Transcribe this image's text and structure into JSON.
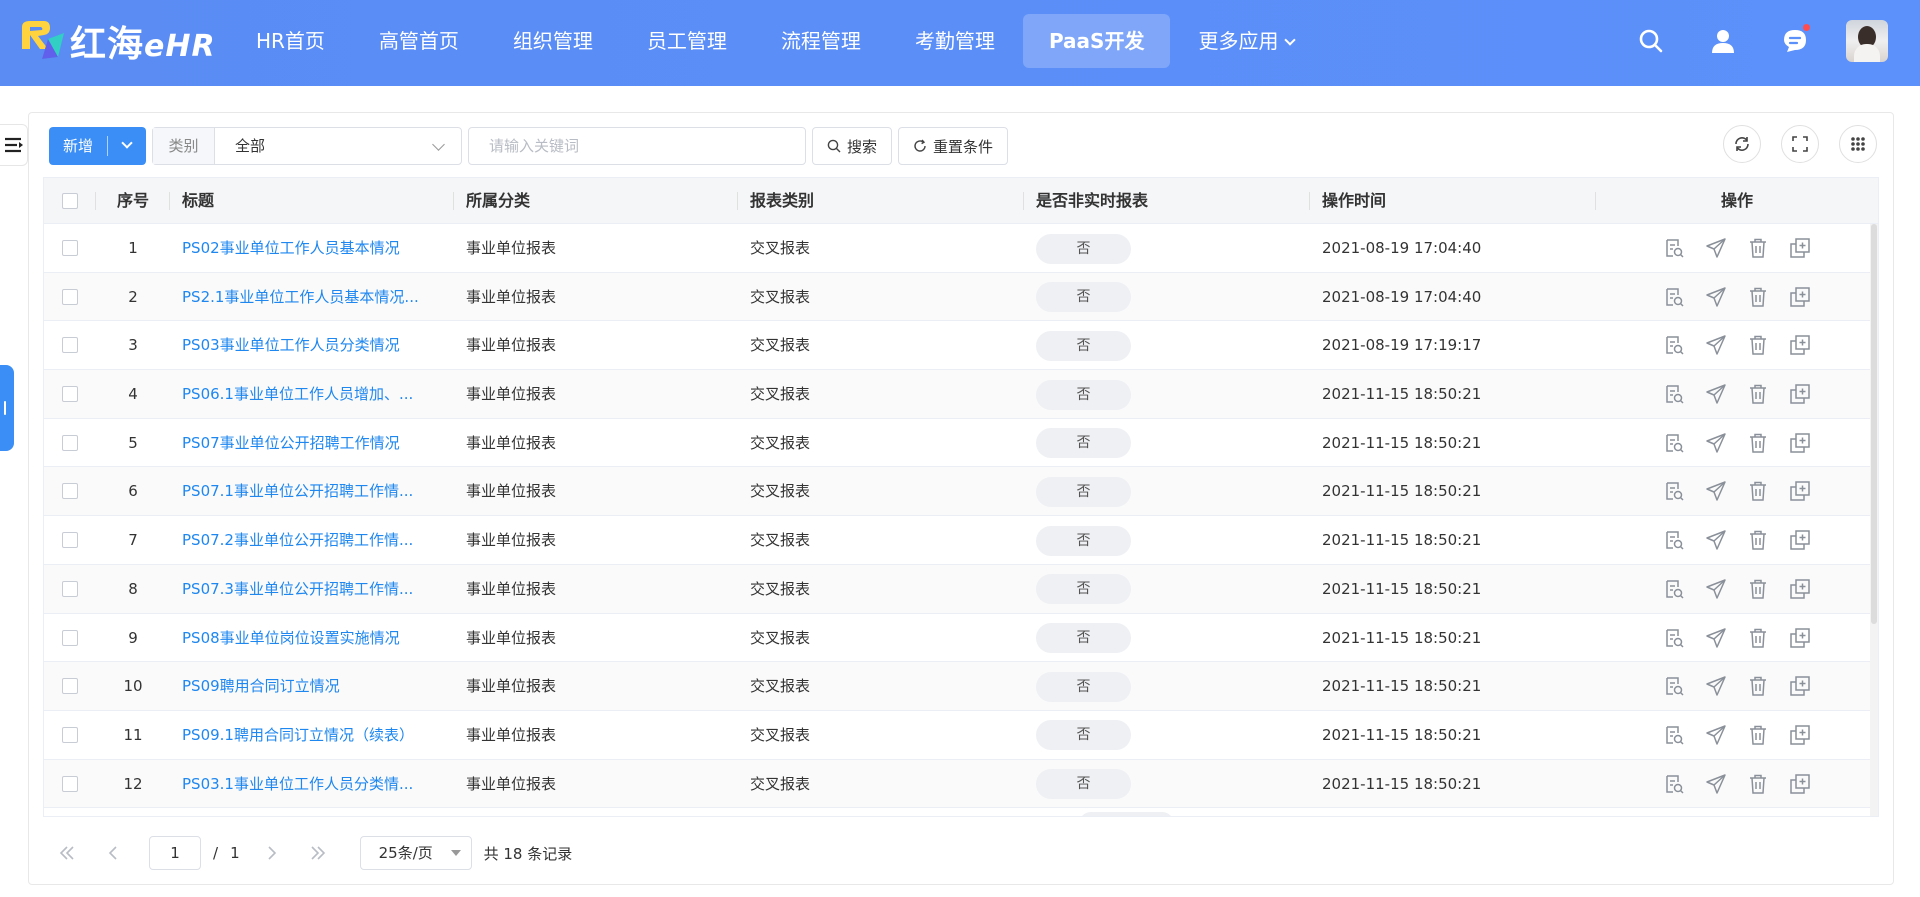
{
  "header": {
    "logo_cn": "红海",
    "logo_en": "eHR",
    "nav": [
      {
        "label": "HR首页",
        "active": false
      },
      {
        "label": "高管首页",
        "active": false
      },
      {
        "label": "组织管理",
        "active": false
      },
      {
        "label": "员工管理",
        "active": false
      },
      {
        "label": "流程管理",
        "active": false
      },
      {
        "label": "考勤管理",
        "active": false
      },
      {
        "label": "PaaS开发",
        "active": true
      },
      {
        "label": "更多应用",
        "active": false
      }
    ],
    "icons": [
      "search-icon",
      "user-icon",
      "message-icon",
      "avatar"
    ]
  },
  "toolbar": {
    "add_label": "新增",
    "category_label": "类别",
    "category_value": "全部",
    "search_placeholder": "请输入关键词",
    "search_label": "搜索",
    "reset_label": "重置条件"
  },
  "table": {
    "columns": {
      "index": "序号",
      "title": "标题",
      "category": "所属分类",
      "type": "报表类别",
      "realtime": "是否非实时报表",
      "time": "操作时间",
      "ops": "操作"
    },
    "rows": [
      {
        "index": "1",
        "title": "PS02事业单位工作人员基本情况",
        "category": "事业单位报表",
        "type": "交叉报表",
        "realtime": "否",
        "time": "2021-08-19 17:04:40"
      },
      {
        "index": "2",
        "title": "PS2.1事业单位工作人员基本情况...",
        "category": "事业单位报表",
        "type": "交叉报表",
        "realtime": "否",
        "time": "2021-08-19 17:04:40"
      },
      {
        "index": "3",
        "title": "PS03事业单位工作人员分类情况",
        "category": "事业单位报表",
        "type": "交叉报表",
        "realtime": "否",
        "time": "2021-08-19 17:19:17"
      },
      {
        "index": "4",
        "title": "PS06.1事业单位工作人员增加、...",
        "category": "事业单位报表",
        "type": "交叉报表",
        "realtime": "否",
        "time": "2021-11-15 18:50:21"
      },
      {
        "index": "5",
        "title": "PS07事业单位公开招聘工作情况",
        "category": "事业单位报表",
        "type": "交叉报表",
        "realtime": "否",
        "time": "2021-11-15 18:50:21"
      },
      {
        "index": "6",
        "title": "PS07.1事业单位公开招聘工作情...",
        "category": "事业单位报表",
        "type": "交叉报表",
        "realtime": "否",
        "time": "2021-11-15 18:50:21"
      },
      {
        "index": "7",
        "title": "PS07.2事业单位公开招聘工作情...",
        "category": "事业单位报表",
        "type": "交叉报表",
        "realtime": "否",
        "time": "2021-11-15 18:50:21"
      },
      {
        "index": "8",
        "title": "PS07.3事业单位公开招聘工作情...",
        "category": "事业单位报表",
        "type": "交叉报表",
        "realtime": "否",
        "time": "2021-11-15 18:50:21"
      },
      {
        "index": "9",
        "title": "PS08事业单位岗位设置实施情况",
        "category": "事业单位报表",
        "type": "交叉报表",
        "realtime": "否",
        "time": "2021-11-15 18:50:21"
      },
      {
        "index": "10",
        "title": "PS09聘用合同订立情况",
        "category": "事业单位报表",
        "type": "交叉报表",
        "realtime": "否",
        "time": "2021-11-15 18:50:21"
      },
      {
        "index": "11",
        "title": "PS09.1聘用合同订立情况（续表）",
        "category": "事业单位报表",
        "type": "交叉报表",
        "realtime": "否",
        "time": "2021-11-15 18:50:21"
      },
      {
        "index": "12",
        "title": "PS03.1事业单位工作人员分类情...",
        "category": "事业单位报表",
        "type": "交叉报表",
        "realtime": "否",
        "time": "2021-11-15 18:50:21"
      }
    ],
    "row_ops": [
      "view-icon",
      "send-icon",
      "delete-icon",
      "copy-icon"
    ]
  },
  "pagination": {
    "current": "1",
    "separator": "/",
    "total_pages": "1",
    "page_size": "25条/页",
    "total_text": "共 18 条记录"
  },
  "colors": {
    "header_bg": "#5b8ff9",
    "primary": "#3a8ef6",
    "link": "#1e87f0"
  }
}
